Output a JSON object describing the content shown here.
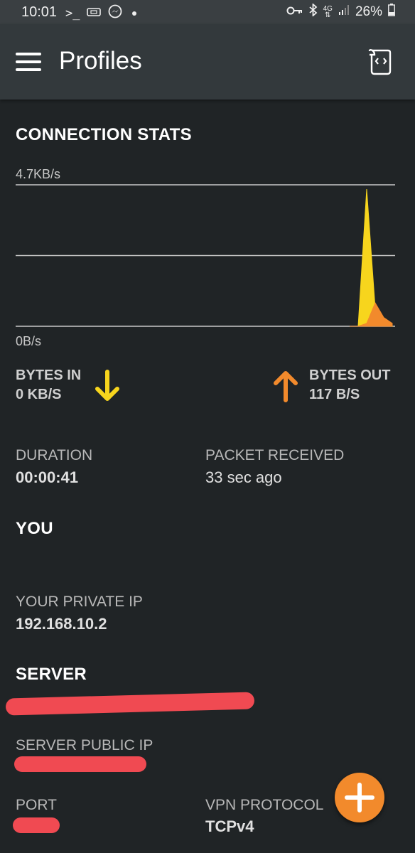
{
  "status_bar": {
    "time": "10:01",
    "left_icons": [
      "terminal-icon",
      "vpn-key-card-icon",
      "messenger-icon",
      "dot-icon"
    ],
    "right_icons": [
      "key-icon",
      "bluetooth-icon",
      "4g-data-icon",
      "signal-icon",
      "battery-icon"
    ],
    "network_label": "4G",
    "battery": "26%"
  },
  "app_bar": {
    "title": "Profiles",
    "menu_icon": "hamburger-menu-icon",
    "action_icon": "log-scroll-icon"
  },
  "connection_stats": {
    "heading": "CONNECTION STATS",
    "chart_data": {
      "type": "area",
      "ylim_labels": [
        "4.7KB/s",
        "0B/s"
      ],
      "grid": true,
      "series": [
        {
          "values": [
            0,
            0,
            0,
            0,
            0,
            0,
            0,
            0,
            0,
            0,
            0,
            0,
            0,
            0,
            0,
            0,
            0,
            0,
            0,
            0,
            0,
            0,
            0,
            0,
            0,
            0,
            0,
            0,
            0,
            4.7,
            0.6,
            0.2,
            0
          ],
          "color": "#f7d51d"
        },
        {
          "values": [
            0,
            0,
            0,
            0,
            0,
            0,
            0,
            0,
            0,
            0,
            0,
            0,
            0,
            0,
            0,
            0,
            0,
            0,
            0,
            0,
            0,
            0,
            0,
            0,
            0,
            0,
            0,
            0,
            0,
            0.1,
            0.8,
            0.3,
            0.1
          ],
          "color": "#f28a2c"
        }
      ]
    },
    "y_max_label": "4.7KB/s",
    "y_min_label": "0B/s",
    "bytes_in_label": "BYTES IN",
    "bytes_in_value": "0 KB/S",
    "bytes_out_label": "BYTES OUT",
    "bytes_out_value": "117 B/S",
    "in_color": "#f7d51d",
    "out_color": "#f28a2c"
  },
  "duration": {
    "label": "DURATION",
    "value": "00:00:41"
  },
  "packet_received": {
    "label": "PACKET RECEIVED",
    "value": "33 sec ago"
  },
  "you": {
    "heading": "YOU",
    "private_ip_label": "YOUR PRIVATE IP",
    "private_ip_value": "192.168.10.2"
  },
  "server": {
    "heading": "SERVER",
    "public_ip_label": "SERVER PUBLIC IP",
    "port_label": "PORT",
    "protocol_label": "VPN PROTOCOL",
    "protocol_value": "TCPv4"
  },
  "fab": {
    "icon": "plus-icon",
    "color": "#f28a2c"
  }
}
